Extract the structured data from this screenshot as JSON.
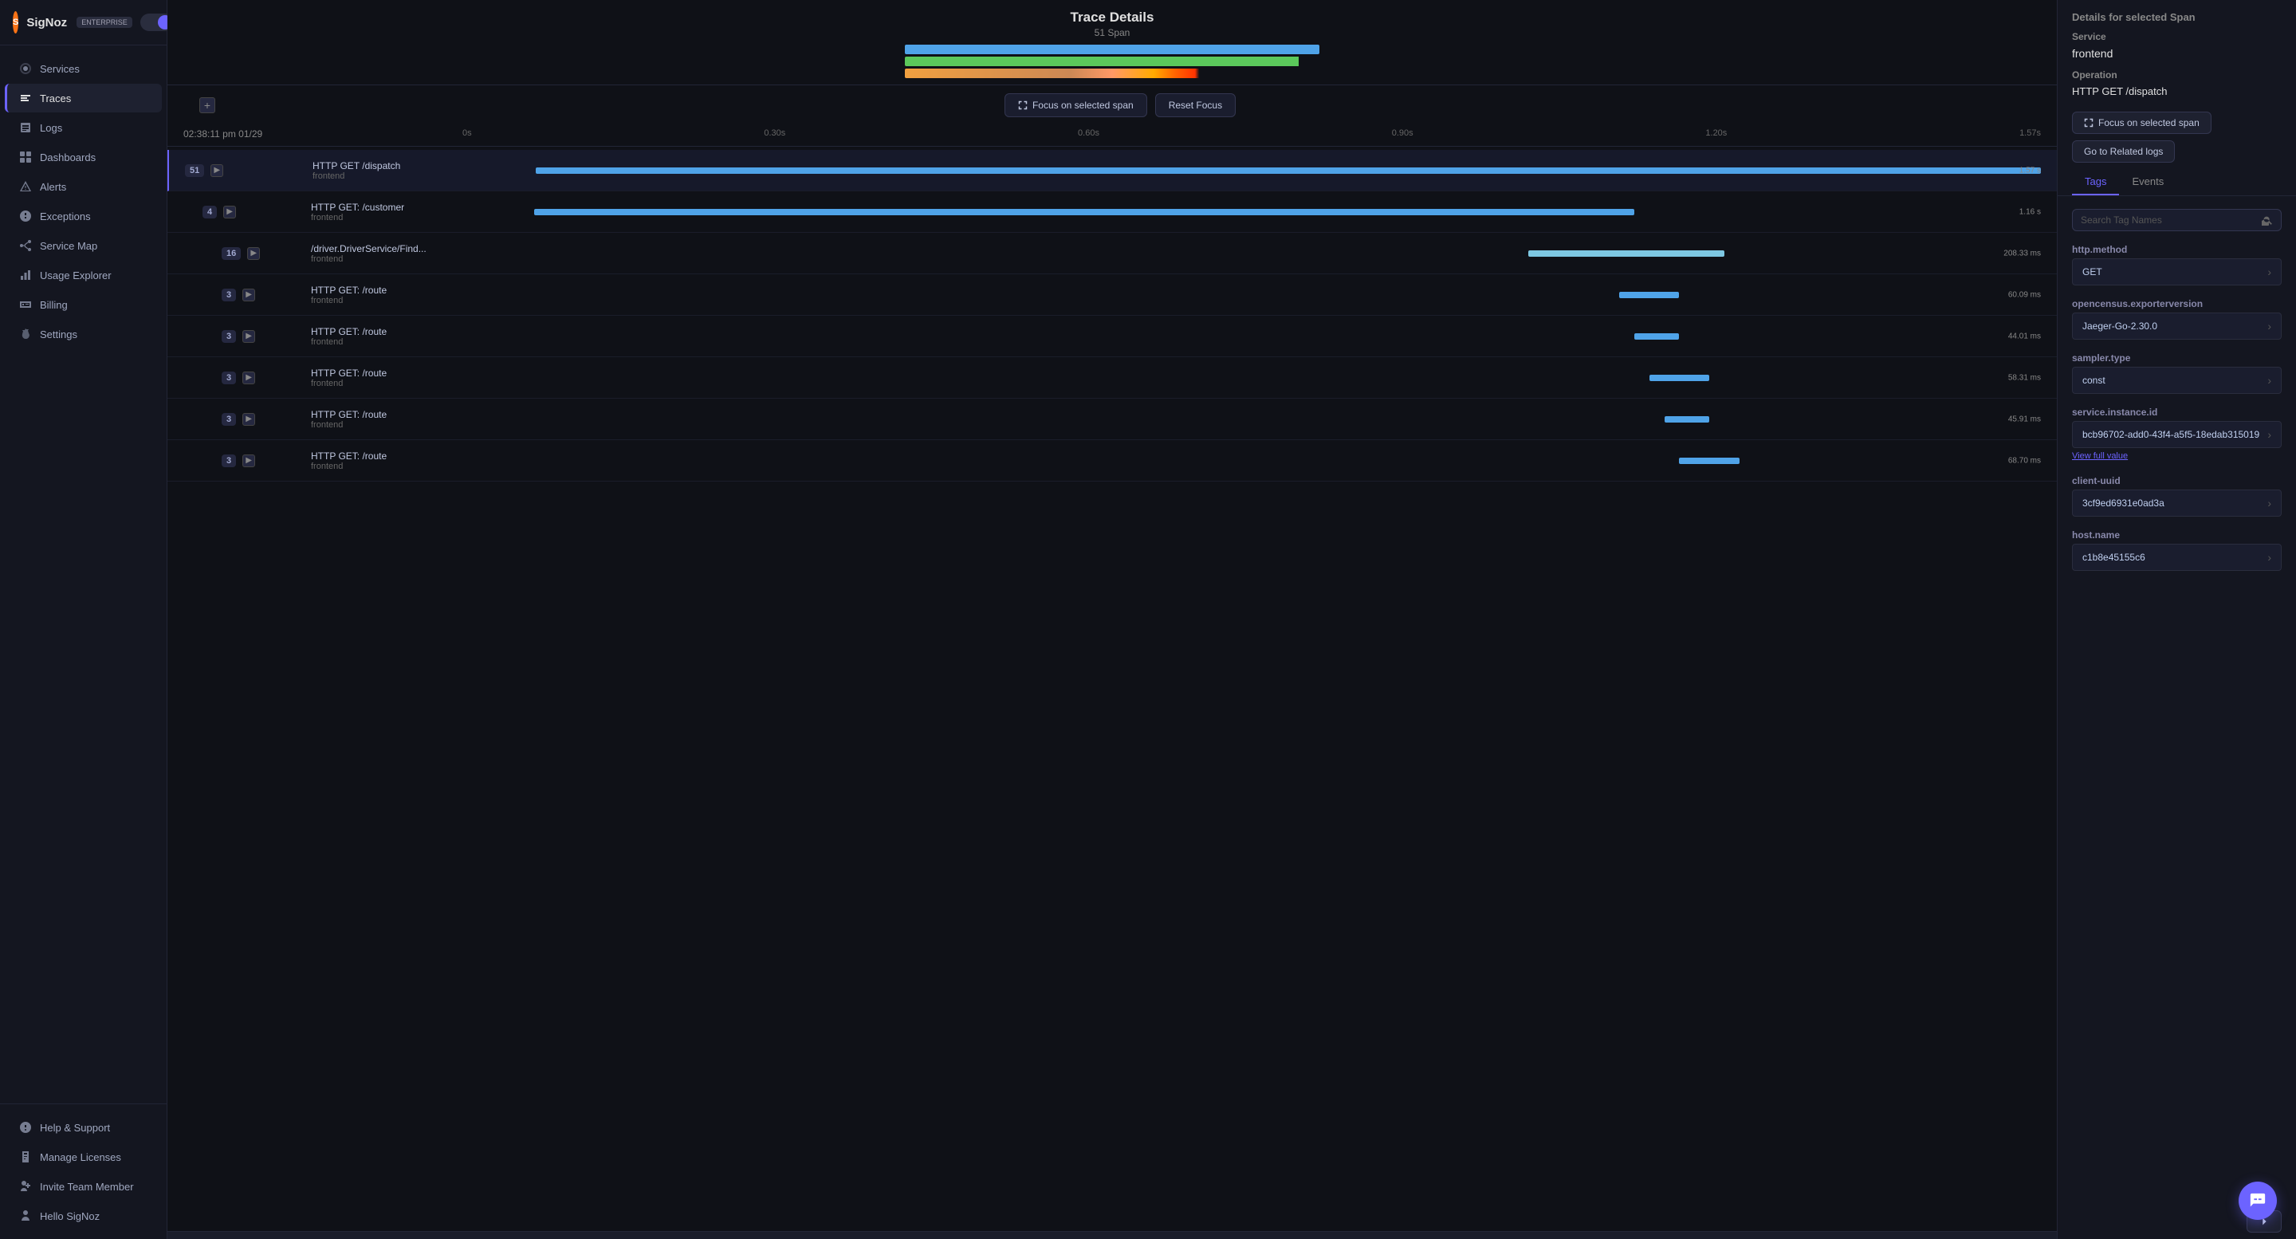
{
  "app": {
    "name": "SigNoz",
    "badge": "ENTERPRISE"
  },
  "sidebar": {
    "items": [
      {
        "id": "services",
        "label": "Services",
        "icon": "services"
      },
      {
        "id": "traces",
        "label": "Traces",
        "icon": "traces",
        "active": true
      },
      {
        "id": "logs",
        "label": "Logs",
        "icon": "logs"
      },
      {
        "id": "dashboards",
        "label": "Dashboards",
        "icon": "dashboards"
      },
      {
        "id": "alerts",
        "label": "Alerts",
        "icon": "alerts"
      },
      {
        "id": "exceptions",
        "label": "Exceptions",
        "icon": "exceptions"
      },
      {
        "id": "service-map",
        "label": "Service Map",
        "icon": "service-map"
      },
      {
        "id": "usage-explorer",
        "label": "Usage Explorer",
        "icon": "usage-explorer"
      },
      {
        "id": "billing",
        "label": "Billing",
        "icon": "billing"
      },
      {
        "id": "settings",
        "label": "Settings",
        "icon": "settings"
      }
    ],
    "bottom_items": [
      {
        "id": "help",
        "label": "Help & Support",
        "icon": "help"
      },
      {
        "id": "licenses",
        "label": "Manage Licenses",
        "icon": "licenses"
      },
      {
        "id": "invite",
        "label": "Invite Team Member",
        "icon": "invite"
      },
      {
        "id": "hello",
        "label": "Hello SigNoz",
        "icon": "user"
      }
    ]
  },
  "trace": {
    "title": "Trace Details",
    "subtitle": "51 Span",
    "timestamp": "02:38:11 pm 01/29",
    "timeline_marks": [
      "0s",
      "0.30s",
      "0.60s",
      "0.90s",
      "1.20s",
      "1.57s"
    ]
  },
  "controls": {
    "focus_label": "Focus on selected span",
    "reset_label": "Reset Focus"
  },
  "spans": [
    {
      "count": 51,
      "indent": 0,
      "name": "HTTP GET /dispatch",
      "service": "frontend",
      "duration": "1.57 s",
      "bar_left": "0%",
      "bar_width": "100%",
      "bar_color": "#4fa3e8"
    },
    {
      "count": 4,
      "indent": 1,
      "name": "HTTP GET: /customer",
      "service": "frontend",
      "duration": "1.16 s",
      "bar_left": "0%",
      "bar_width": "73%",
      "bar_color": "#4fa3e8"
    },
    {
      "count": 16,
      "indent": 2,
      "name": "/driver.DriverService/Find...",
      "service": "frontend",
      "duration": "208.33 ms",
      "bar_left": "66%",
      "bar_width": "13%",
      "bar_color": "#7ec8e3"
    },
    {
      "count": 3,
      "indent": 2,
      "name": "HTTP GET: /route",
      "service": "frontend",
      "duration": "60.09 ms",
      "bar_left": "72%",
      "bar_width": "4%",
      "bar_color": "#4fa3e8"
    },
    {
      "count": 3,
      "indent": 2,
      "name": "HTTP GET: /route",
      "service": "frontend",
      "duration": "44.01 ms",
      "bar_left": "73%",
      "bar_width": "3%",
      "bar_color": "#4fa3e8"
    },
    {
      "count": 3,
      "indent": 2,
      "name": "HTTP GET: /route",
      "service": "frontend",
      "duration": "58.31 ms",
      "bar_left": "74%",
      "bar_width": "4%",
      "bar_color": "#4fa3e8"
    },
    {
      "count": 3,
      "indent": 2,
      "name": "HTTP GET: /route",
      "service": "frontend",
      "duration": "45.91 ms",
      "bar_left": "75%",
      "bar_width": "3%",
      "bar_color": "#4fa3e8"
    },
    {
      "count": 3,
      "indent": 2,
      "name": "HTTP GET: /route",
      "service": "frontend",
      "duration": "68.70 ms",
      "bar_left": "76%",
      "bar_width": "4%",
      "bar_color": "#4fa3e8"
    }
  ],
  "right_panel": {
    "title": "Details for selected Span",
    "service_label": "Service",
    "service_value": "frontend",
    "operation_label": "Operation",
    "operation_value": "HTTP GET /dispatch",
    "focus_btn": "Focus on selected span",
    "related_logs_btn": "Go to Related logs",
    "tabs": [
      "Tags",
      "Events"
    ],
    "active_tab": "Tags",
    "search_placeholder": "Search Tag Names",
    "tags": [
      {
        "name": "http.method",
        "value": "GET"
      },
      {
        "name": "opencensus.exporterversion",
        "value": "Jaeger-Go-2.30.0"
      },
      {
        "name": "sampler.type",
        "value": "const"
      },
      {
        "name": "service.instance.id",
        "value": "bcb96702-add0-43f4-a5f5-18edab315019",
        "has_view_link": true,
        "view_link_label": "View full value"
      },
      {
        "name": "client-uuid",
        "value": "3cf9ed6931e0ad3a"
      },
      {
        "name": "host.name",
        "value": "c1b8e45155c6"
      }
    ]
  },
  "trace_bars": [
    {
      "color": "#4fa3e8",
      "width": "100%"
    },
    {
      "color": "#5bc85b",
      "width": "98%"
    },
    {
      "color": "#f0a040",
      "width": "95%"
    }
  ]
}
